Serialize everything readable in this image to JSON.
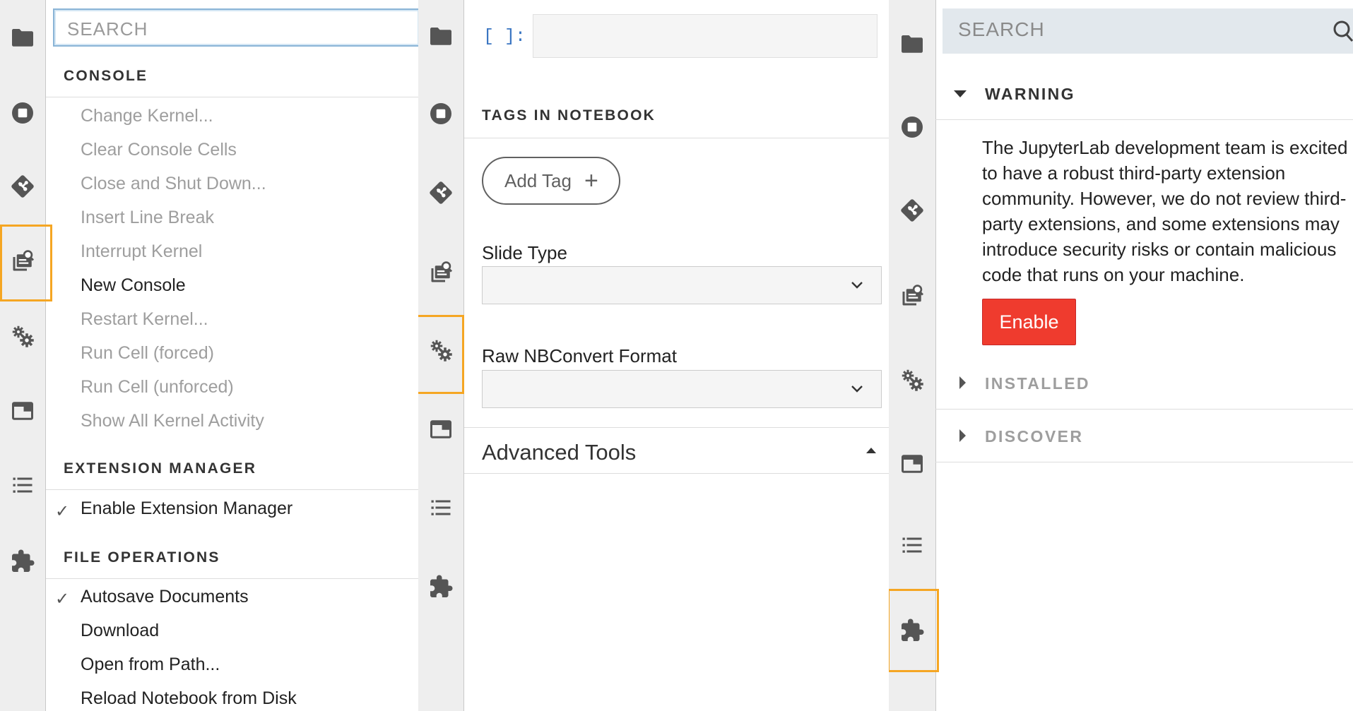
{
  "command_palette": {
    "search_placeholder": "SEARCH",
    "sections": [
      {
        "title": "CONSOLE",
        "items": [
          {
            "label": "Change Kernel...",
            "enabled": false
          },
          {
            "label": "Clear Console Cells",
            "enabled": false
          },
          {
            "label": "Close and Shut Down...",
            "enabled": false
          },
          {
            "label": "Insert Line Break",
            "enabled": false
          },
          {
            "label": "Interrupt Kernel",
            "enabled": false
          },
          {
            "label": "New Console",
            "enabled": true
          },
          {
            "label": "Restart Kernel...",
            "enabled": false
          },
          {
            "label": "Run Cell (forced)",
            "enabled": false
          },
          {
            "label": "Run Cell (unforced)",
            "enabled": false
          },
          {
            "label": "Show All Kernel Activity",
            "enabled": false
          }
        ]
      },
      {
        "title": "EXTENSION MANAGER",
        "items": [
          {
            "label": "Enable Extension Manager",
            "enabled": true,
            "checked": true
          }
        ]
      },
      {
        "title": "FILE OPERATIONS",
        "items": [
          {
            "label": "Autosave Documents",
            "enabled": true,
            "checked": true
          },
          {
            "label": "Download",
            "enabled": true
          },
          {
            "label": "Open from Path...",
            "enabled": true
          },
          {
            "label": "Reload Notebook from Disk",
            "enabled": true
          }
        ]
      }
    ]
  },
  "property_inspector": {
    "prompt": "[ ]:",
    "tags_header": "TAGS IN NOTEBOOK",
    "add_tag_label": "Add Tag",
    "slide_type_label": "Slide Type",
    "slide_type_value": "",
    "raw_format_label": "Raw NBConvert Format",
    "raw_format_value": "",
    "advanced_tools_label": "Advanced Tools"
  },
  "extension_manager": {
    "search_placeholder": "SEARCH",
    "warning_header": "WARNING",
    "warning_text": "The JupyterLab development team is excited to have a robust third-party extension community. However, we do not review third-party extensions, and some extensions may introduce security risks or contain malicious code that runs on your machine.",
    "enable_button": "Enable",
    "installed_header": "INSTALLED",
    "discover_header": "DISCOVER"
  },
  "sidebar_icons": [
    "folder-icon",
    "running-icon",
    "git-icon",
    "command-palette-icon",
    "property-inspector-icon",
    "tabs-icon",
    "toc-icon",
    "extension-icon"
  ],
  "highlighted_tabs": [
    "command-palette-icon",
    "property-inspector-icon",
    "extension-icon"
  ],
  "colors": {
    "highlight": "#f5a623",
    "enable_button": "#ef3b2e",
    "prompt": "#3b76c2",
    "iconbar": "#eeeeee"
  }
}
